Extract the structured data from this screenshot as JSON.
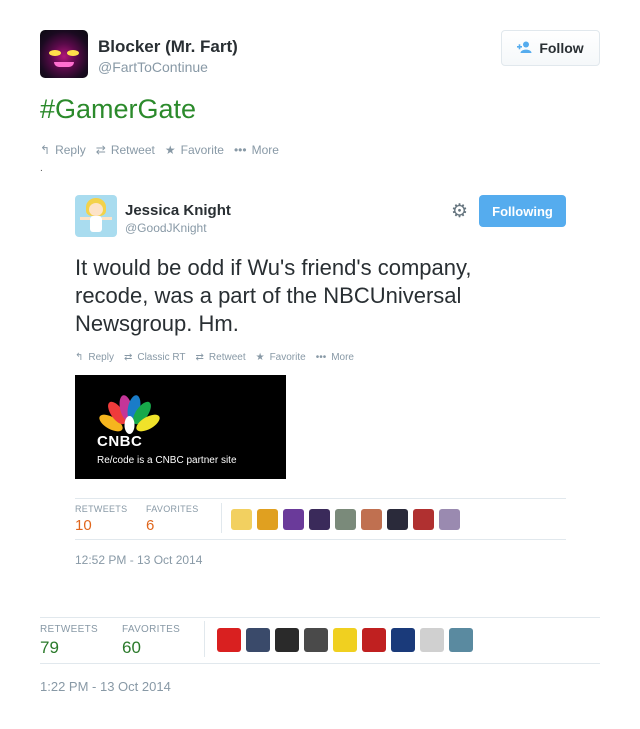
{
  "outer_tweet": {
    "author_name": "Blocker (Mr. Fart)",
    "author_handle": "@FartToContinue",
    "follow_label": "Follow",
    "text": "#GamerGate",
    "actions": {
      "reply": "Reply",
      "retweet": "Retweet",
      "favorite": "Favorite",
      "more": "More"
    },
    "dot": ".",
    "stats": {
      "retweets_label": "RETWEETS",
      "retweets": "79",
      "favorites_label": "FAVORITES",
      "favorites": "60"
    },
    "timestamp": "1:22 PM - 13 Oct 2014",
    "faces_colors": [
      "#d92020",
      "#3a4a6a",
      "#2a2a2a",
      "#4a4a4a",
      "#f0d020",
      "#c02020",
      "#1a3a7a",
      "#d0d0d0",
      "#5a8aa0"
    ]
  },
  "inner_tweet": {
    "author_name": "Jessica Knight",
    "author_handle": "@GoodJKnight",
    "following_label": "Following",
    "text": "It would be odd if Wu's friend's company, recode, was a part of the NBCUniversal Newsgroup. Hm.",
    "actions": {
      "reply": "Reply",
      "classic_rt": "Classic RT",
      "retweet": "Retweet",
      "favorite": "Favorite",
      "more": "More"
    },
    "card": {
      "logo_text": "CNBC",
      "caption": "Re/code is a CNBC partner site"
    },
    "stats": {
      "retweets_label": "RETWEETS",
      "retweets": "10",
      "favorites_label": "FAVORITES",
      "favorites": "6"
    },
    "timestamp": "12:52 PM - 13 Oct 2014",
    "faces_colors": [
      "#f2d060",
      "#e0a020",
      "#6a3a9a",
      "#3a2a5a",
      "#7a8a7a",
      "#c07050",
      "#2a2a3a",
      "#b03030",
      "#9a8ab0"
    ]
  },
  "colors": {
    "accent_blue": "#55acee",
    "hashtag_green": "#2b8a2b",
    "stat_orange": "#e0661c",
    "stat_green": "#2b7a2b",
    "muted_gray": "#8899a6"
  },
  "icons": {
    "reply": "reply-icon",
    "retweet": "retweet-icon",
    "favorite": "star-icon",
    "more": "ellipsis-icon",
    "gear": "gear-icon",
    "follow": "add-person-icon"
  }
}
